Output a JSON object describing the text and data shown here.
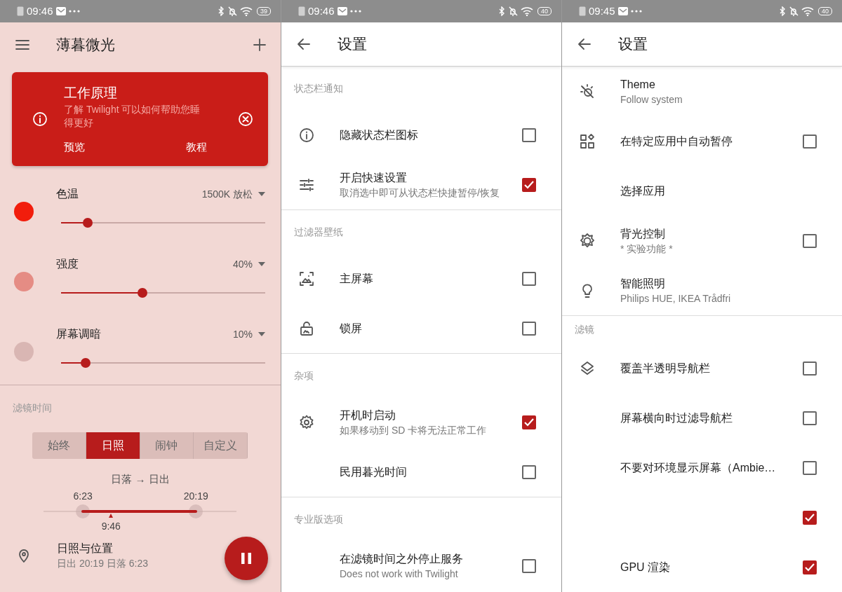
{
  "screens": [
    {
      "kind": "main",
      "status_bar": {
        "time": "09:46",
        "battery": "39"
      },
      "title": "薄暮微光",
      "info_card": {
        "title": "工作原理",
        "text": "了解 Twilight 可以如何帮助您睡得更好",
        "buttons": [
          "预览",
          "教程"
        ]
      },
      "sliders": [
        {
          "label": "色温",
          "value": "1500K 放松",
          "level": 0.13,
          "color": "#f21d0c"
        },
        {
          "label": "强度",
          "value": "40%",
          "level": 0.4,
          "color": "#e58c84"
        },
        {
          "label": "屏幕调暗",
          "value": "10%",
          "level": 0.12,
          "color": "#d9b6b3"
        }
      ],
      "schedule": {
        "header": "滤镜时间",
        "modes": [
          {
            "label": "始终",
            "selected": false
          },
          {
            "label": "日照",
            "selected": true
          },
          {
            "label": "闹钟",
            "selected": false
          },
          {
            "label": "自定义",
            "selected": false
          }
        ],
        "range": "日落 → 日出",
        "start": "6:23",
        "end": "20:19",
        "now": "9:46"
      },
      "location": {
        "title": "日照与位置",
        "subtitle": "日出 20:19 日落 6:23"
      }
    },
    {
      "kind": "settings",
      "status_bar": {
        "time": "09:46",
        "battery": "40"
      },
      "title": "设置",
      "sections": [
        {
          "header": "状态栏通知",
          "items": [
            {
              "kind": "checkbox",
              "title": "隐藏状态栏图标",
              "checked": false
            },
            {
              "kind": "checkbox",
              "title": "开启快速设置",
              "subtitle": "取消选中即可从状态栏快捷暂停/恢复",
              "checked": true
            }
          ]
        },
        {
          "header": "过滤器壁纸",
          "items": [
            {
              "kind": "checkbox",
              "title": "主屏幕",
              "checked": false
            },
            {
              "kind": "checkbox",
              "title": "锁屏",
              "checked": false
            }
          ]
        },
        {
          "header": "杂项",
          "items": [
            {
              "kind": "checkbox",
              "title": "开机时启动",
              "subtitle": "如果移动到 SD 卡将无法正常工作",
              "checked": true
            },
            {
              "kind": "checkbox",
              "title": "民用暮光时间",
              "checked": false
            }
          ]
        },
        {
          "header": "专业版选项",
          "items": [
            {
              "kind": "checkbox",
              "title": "在滤镜时间之外停止服务",
              "subtitle": "Does not work with Twilight",
              "checked": false
            }
          ]
        }
      ]
    },
    {
      "kind": "settings",
      "status_bar": {
        "time": "09:45",
        "battery": "40"
      },
      "title": "设置",
      "sections": [
        {
          "items": [
            {
              "kind": "plain",
              "title": "Theme",
              "subtitle": "Follow system"
            },
            {
              "kind": "checkbox",
              "title": "在特定应用中自动暂停",
              "checked": false
            },
            {
              "kind": "plain",
              "title": "选择应用"
            },
            {
              "kind": "checkbox",
              "title": "背光控制",
              "subtitle": "* 实验功能 *",
              "checked": false
            },
            {
              "kind": "plain",
              "title": "智能照明",
              "subtitle": "Philips HUE, IKEA Trådfri"
            }
          ]
        },
        {
          "header": "滤镜",
          "items": [
            {
              "kind": "checkbox",
              "title": "覆盖半透明导航栏",
              "checked": false
            },
            {
              "kind": "checkbox",
              "title": "屏幕横向时过滤导航栏",
              "checked": false
            },
            {
              "kind": "checkbox",
              "title": "不要对环境显示屏幕（Ambie…",
              "checked": false
            },
            {
              "kind": "checkbox",
              "checked": true
            },
            {
              "kind": "checkbox",
              "title": "GPU 渲染",
              "checked": true
            }
          ]
        }
      ]
    }
  ]
}
